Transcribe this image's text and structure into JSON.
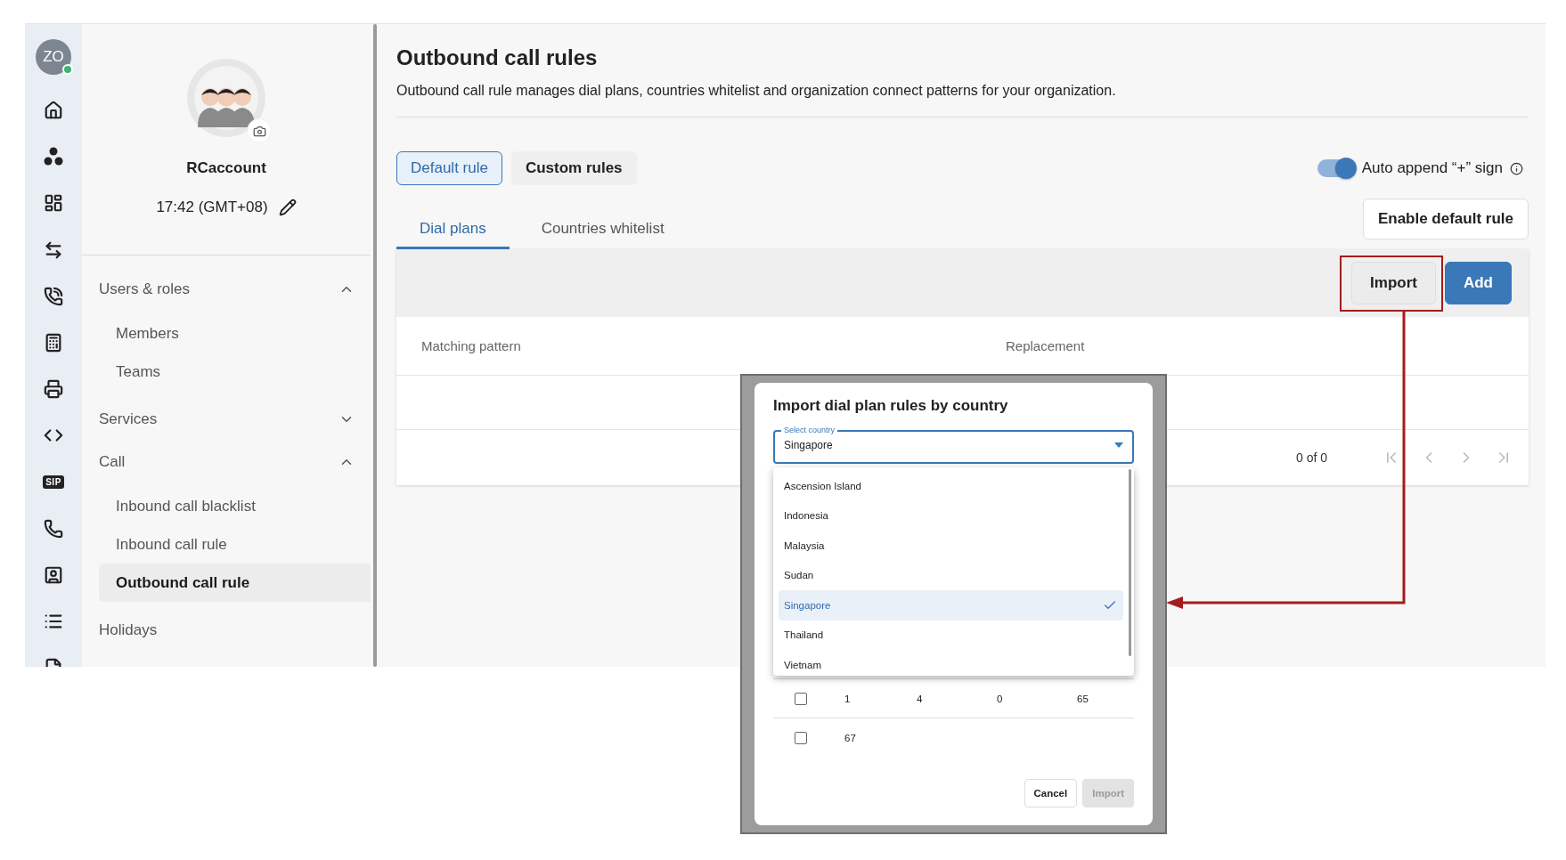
{
  "rail": {
    "initials": "ZO",
    "online": true,
    "items": [
      {
        "kind": "home"
      },
      {
        "kind": "groups"
      },
      {
        "kind": "dashboard"
      },
      {
        "kind": "transfer"
      },
      {
        "kind": "calls"
      },
      {
        "kind": "fax"
      },
      {
        "kind": "printer"
      },
      {
        "kind": "code"
      },
      {
        "kind": "badge",
        "label": "SIP"
      },
      {
        "kind": "telephone"
      },
      {
        "kind": "contact"
      },
      {
        "kind": "list"
      },
      {
        "kind": "file"
      }
    ]
  },
  "profile": {
    "name": "RCaccount",
    "time": "17:42 (GMT+08)"
  },
  "nav": [
    {
      "label": "Users & roles",
      "kind": "group",
      "expanded": true,
      "children": [
        {
          "label": "Members",
          "selected": false
        },
        {
          "label": "Teams",
          "selected": false
        }
      ]
    },
    {
      "label": "Services",
      "kind": "group",
      "expanded": false
    },
    {
      "label": "Call",
      "kind": "group",
      "expanded": true,
      "children": [
        {
          "label": "Inbound call blacklist",
          "selected": false
        },
        {
          "label": "Inbound call rule",
          "selected": false
        },
        {
          "label": "Outbound call rule",
          "selected": true
        }
      ]
    },
    {
      "label": "Holidays",
      "kind": "link"
    }
  ],
  "page": {
    "title": "Outbound call rules",
    "description": "Outbound call rule manages dial plans, countries whitelist and organization connect patterns for your organization."
  },
  "rule_tabs": [
    {
      "label": "Default rule",
      "selected": true
    },
    {
      "label": "Custom rules",
      "selected": false
    }
  ],
  "auto_append": {
    "label": "Auto append “+” sign",
    "on": true
  },
  "enable_button": "Enable default rule",
  "sub_tabs": [
    {
      "label": "Dial plans",
      "selected": true
    },
    {
      "label": "Countries whitelist",
      "selected": false
    }
  ],
  "toolbar": [
    {
      "label": "Import",
      "kind": "secondary"
    },
    {
      "label": "Add",
      "kind": "primary"
    }
  ],
  "table": {
    "columns": [
      "Matching pattern",
      "Replacement"
    ]
  },
  "pagination": {
    "range": "0 of 0"
  },
  "dialog": {
    "title": "Import dial plan rules by country",
    "select": {
      "label": "Select country",
      "value": "Singapore",
      "options": [
        {
          "label": "Ascension Island",
          "selected": false
        },
        {
          "label": "Indonesia",
          "selected": false
        },
        {
          "label": "Malaysia",
          "selected": false
        },
        {
          "label": "Sudan",
          "selected": false
        },
        {
          "label": "Singapore",
          "selected": true
        },
        {
          "label": "Thailand",
          "selected": false
        },
        {
          "label": "Vietnam",
          "selected": false
        }
      ]
    },
    "rows": [
      {
        "checked": false,
        "cells": [
          "1",
          "4",
          "0",
          "65"
        ]
      },
      {
        "checked": false,
        "cells": [
          "67"
        ]
      }
    ],
    "buttons": [
      {
        "label": "Cancel",
        "disabled": false
      },
      {
        "label": "Import",
        "disabled": true
      }
    ]
  }
}
